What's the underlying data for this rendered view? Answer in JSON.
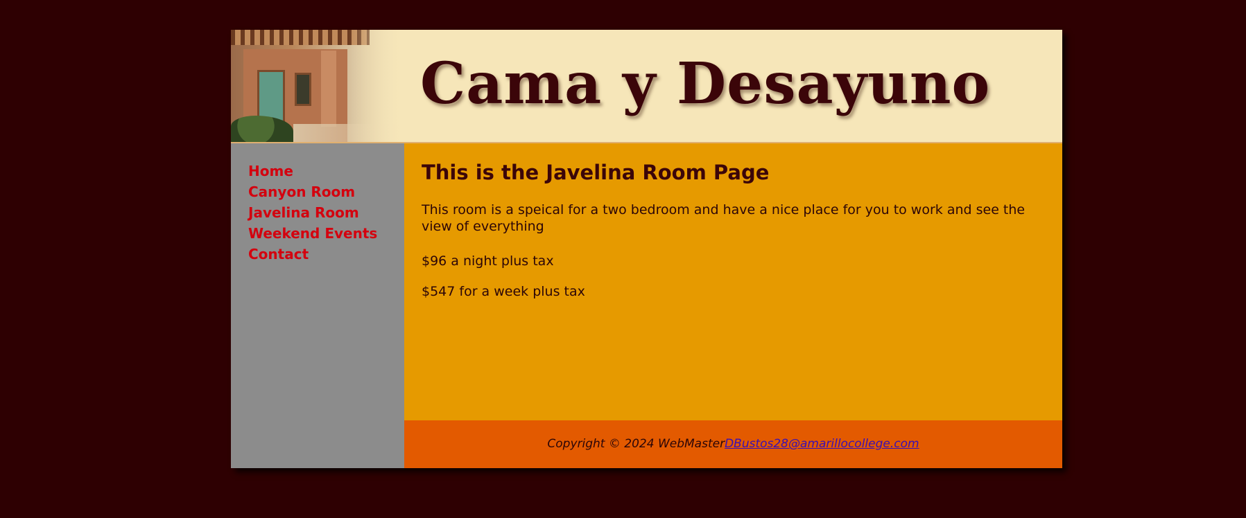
{
  "header": {
    "site_title": "Cama y Desayuno"
  },
  "nav": {
    "items": [
      {
        "label": "Home"
      },
      {
        "label": "Canyon Room"
      },
      {
        "label": "Javelina Room"
      },
      {
        "label": "Weekend Events"
      },
      {
        "label": "Contact"
      }
    ]
  },
  "main": {
    "heading": "This is the Javelina Room Page",
    "description": "This room is a speical for a two bedroom and have a nice place for you to work and see the view of everything",
    "price_night": "$96 a night plus tax",
    "price_week": "$547 for a week plus tax"
  },
  "footer": {
    "copyright": "Copyright © 2024 WebMaster",
    "email": "DBustos28@amarillocollege.com"
  },
  "colors": {
    "page_background": "#2e0002",
    "header_background": "#f6e6b9",
    "title_color": "#3b0509",
    "nav_background": "#8c8c8c",
    "nav_link": "#d4000e",
    "main_background": "#e69a00",
    "footer_background": "#e35a00",
    "footer_link": "#3a0fb5"
  }
}
